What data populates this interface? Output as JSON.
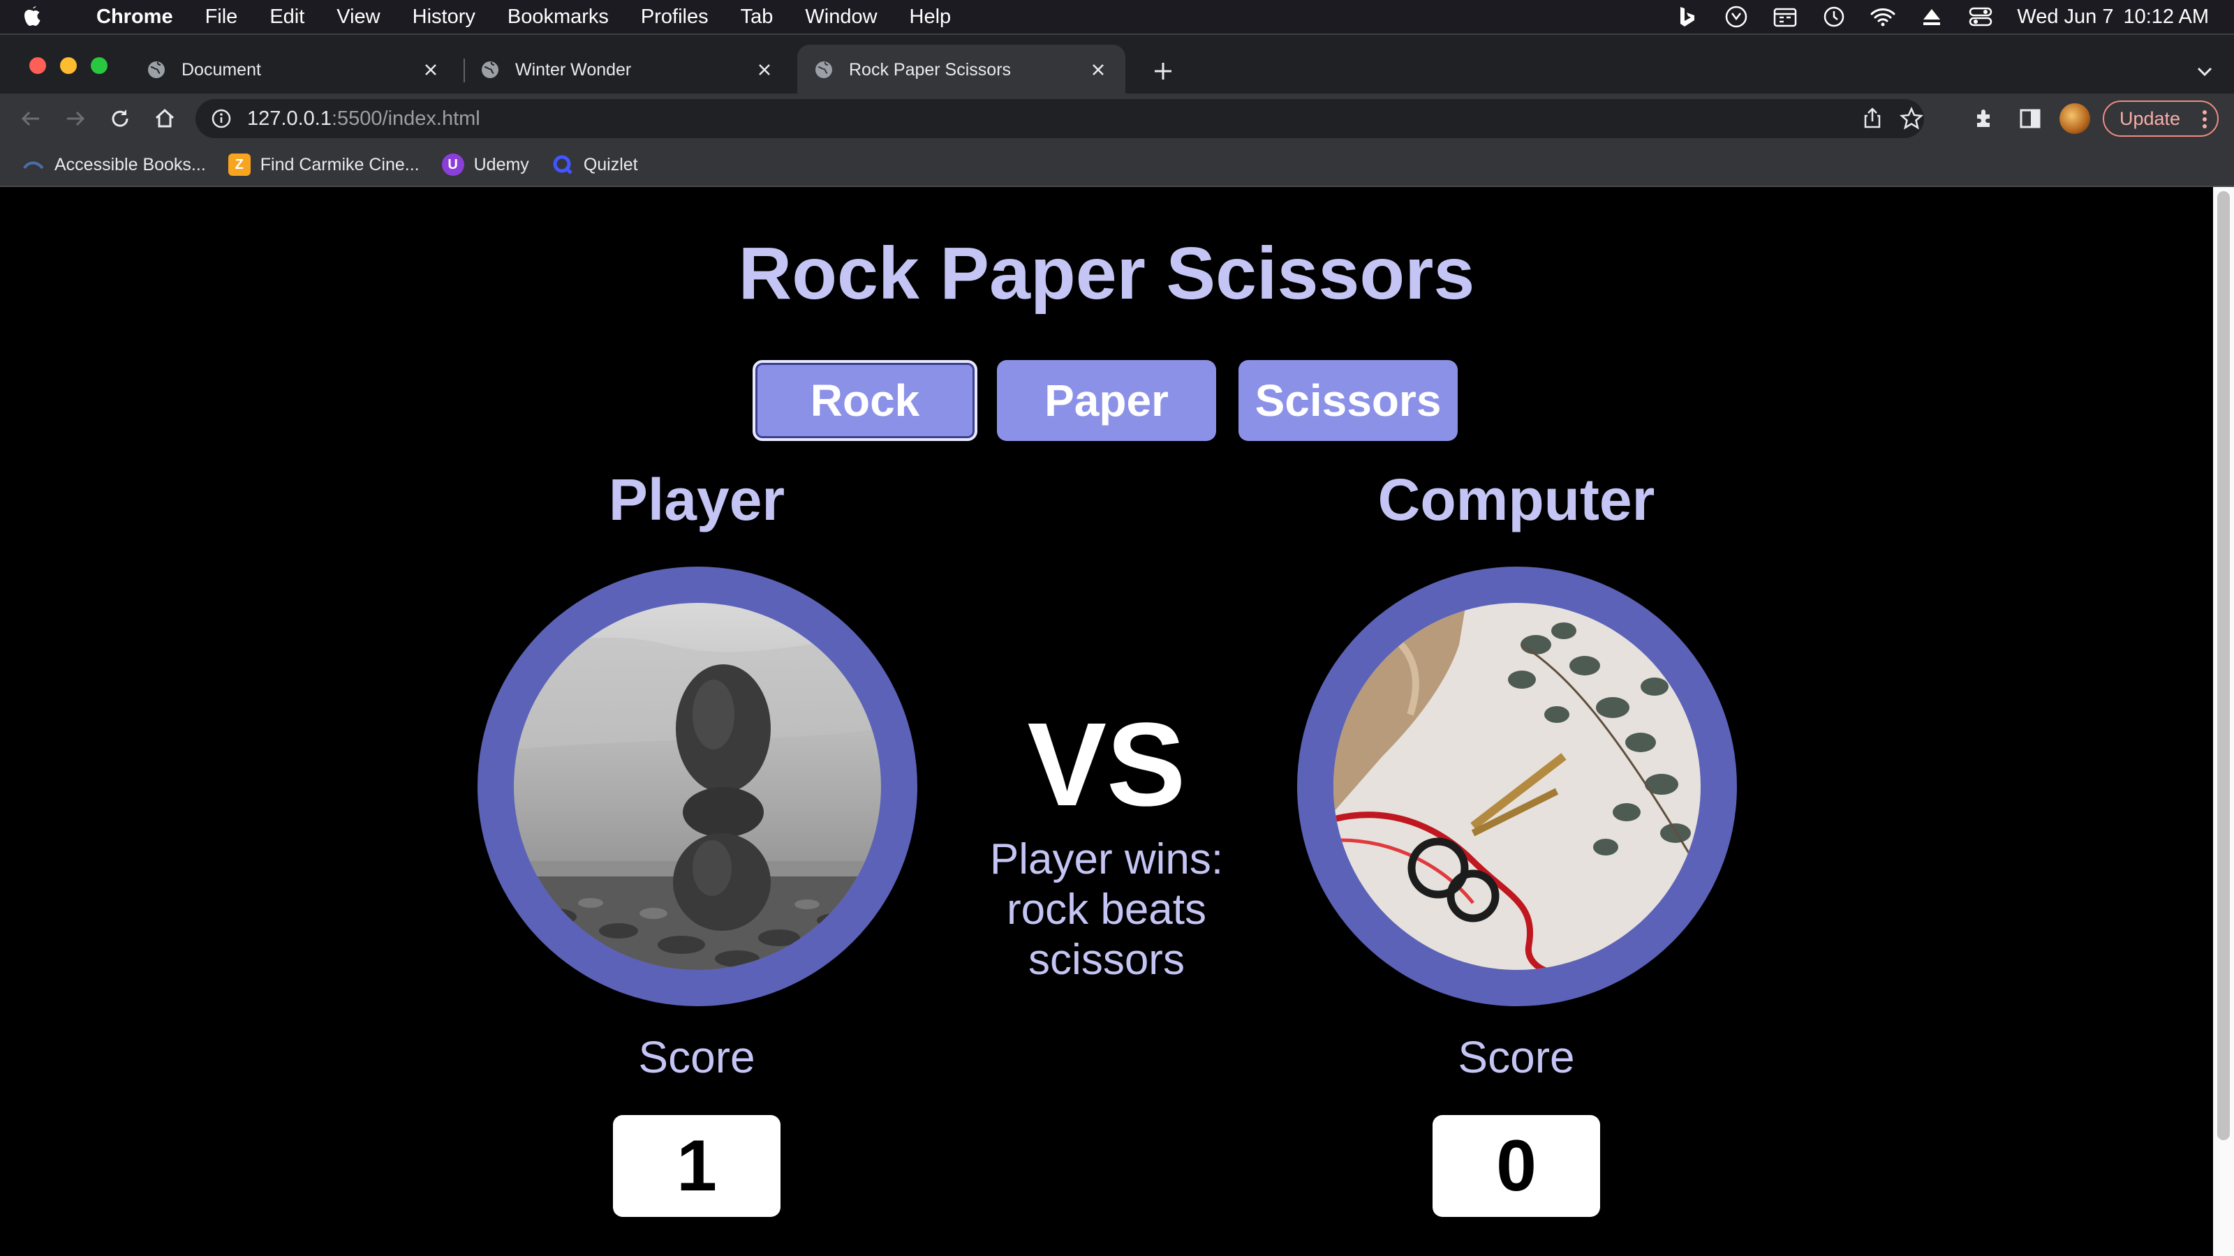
{
  "menubar": {
    "app": "Chrome",
    "items": [
      "File",
      "Edit",
      "View",
      "History",
      "Bookmarks",
      "Profiles",
      "Tab",
      "Window",
      "Help"
    ],
    "date": "Wed Jun 7",
    "time": "10:12 AM"
  },
  "tabs": [
    {
      "title": "Document"
    },
    {
      "title": "Winter Wonder"
    },
    {
      "title": "Rock Paper Scissors"
    }
  ],
  "address": {
    "host": "127.0.0.1",
    "path": ":5500/index.html"
  },
  "toolbar": {
    "update_label": "Update"
  },
  "bookmarks": [
    {
      "label": "Accessible Books...",
      "icon": "books-icon"
    },
    {
      "label": "Find Carmike Cine...",
      "icon": "carmike-icon"
    },
    {
      "label": "Udemy",
      "icon": "udemy-icon"
    },
    {
      "label": "Quizlet",
      "icon": "quizlet-icon"
    }
  ],
  "game": {
    "title": "Rock Paper Scissors",
    "choices": [
      "Rock",
      "Paper",
      "Scissors"
    ],
    "selected_choice": "Rock",
    "player_label": "Player",
    "computer_label": "Computer",
    "vs": "VS",
    "result": "Player wins: rock beats scissors",
    "score_label": "Score",
    "player_score": "1",
    "computer_score": "0",
    "player_image": "stacked-rocks-photo",
    "computer_image": "scissors-ribbon-photo"
  },
  "colors": {
    "accent": "#8c91e8",
    "ring": "#5c62b7",
    "text": "#c4c5f5",
    "background": "#000000"
  }
}
